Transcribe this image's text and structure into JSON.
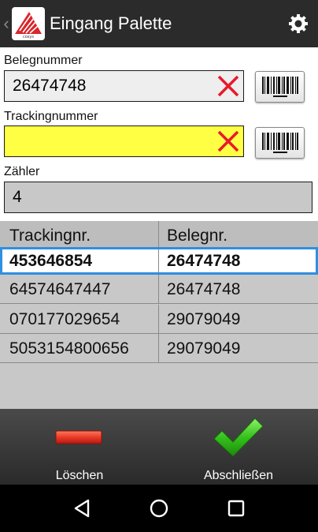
{
  "header": {
    "back_icon": "chevron-left-icon",
    "title": "Eingang Palette",
    "settings_icon": "gear-icon"
  },
  "form": {
    "belegnummer": {
      "label": "Belegnummer",
      "value": "26474748"
    },
    "trackingnummer": {
      "label": "Trackingnummer",
      "value": ""
    },
    "zaehler": {
      "label": "Zähler",
      "value": "4"
    }
  },
  "table": {
    "headers": [
      "Trackingnr.",
      "Belegnr."
    ],
    "rows": [
      [
        "453646854",
        "26474748"
      ],
      [
        "64574647447",
        "26474748"
      ],
      [
        "070177029654",
        "29079049"
      ],
      [
        "5053154800656",
        "29079049"
      ]
    ]
  },
  "actions": {
    "delete_label": "Löschen",
    "finish_label": "Abschließen"
  },
  "colors": {
    "tracking_field": "#ffff44",
    "selection_outline": "#2f8fe0",
    "clear_x": "#e8192c",
    "delete_bar": "#e83a2a",
    "check": "#34c21c"
  }
}
